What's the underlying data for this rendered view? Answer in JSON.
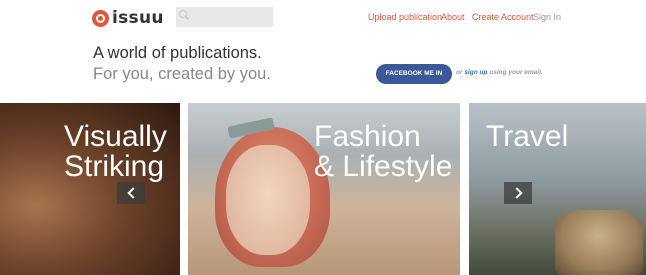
{
  "brand": {
    "logo_text": "issuu",
    "accent": "#e0563c"
  },
  "search": {
    "placeholder": "",
    "value": ""
  },
  "nav": {
    "upload": "Upload publication",
    "about": "About",
    "create_account": "Create Account",
    "sign_in": "Sign In"
  },
  "hero": {
    "tagline_primary": "A world of publications.",
    "tagline_secondary": "For you, created by you."
  },
  "signup": {
    "facebook_button": "FACEBOOK ME IN",
    "or_text": "or",
    "link_text": "sign up",
    "suffix_text": "using your email.",
    "facebook_color": "#3b5998"
  },
  "tiles": [
    {
      "title_line1": "Visually",
      "title_line2": "Striking"
    },
    {
      "title_line1": "Fashion",
      "title_line2": "& Lifestyle"
    },
    {
      "title_line1": "Travel",
      "title_line2": ""
    }
  ],
  "carousel": {
    "prev_icon": "chevron-left-icon",
    "next_icon": "chevron-right-icon"
  }
}
